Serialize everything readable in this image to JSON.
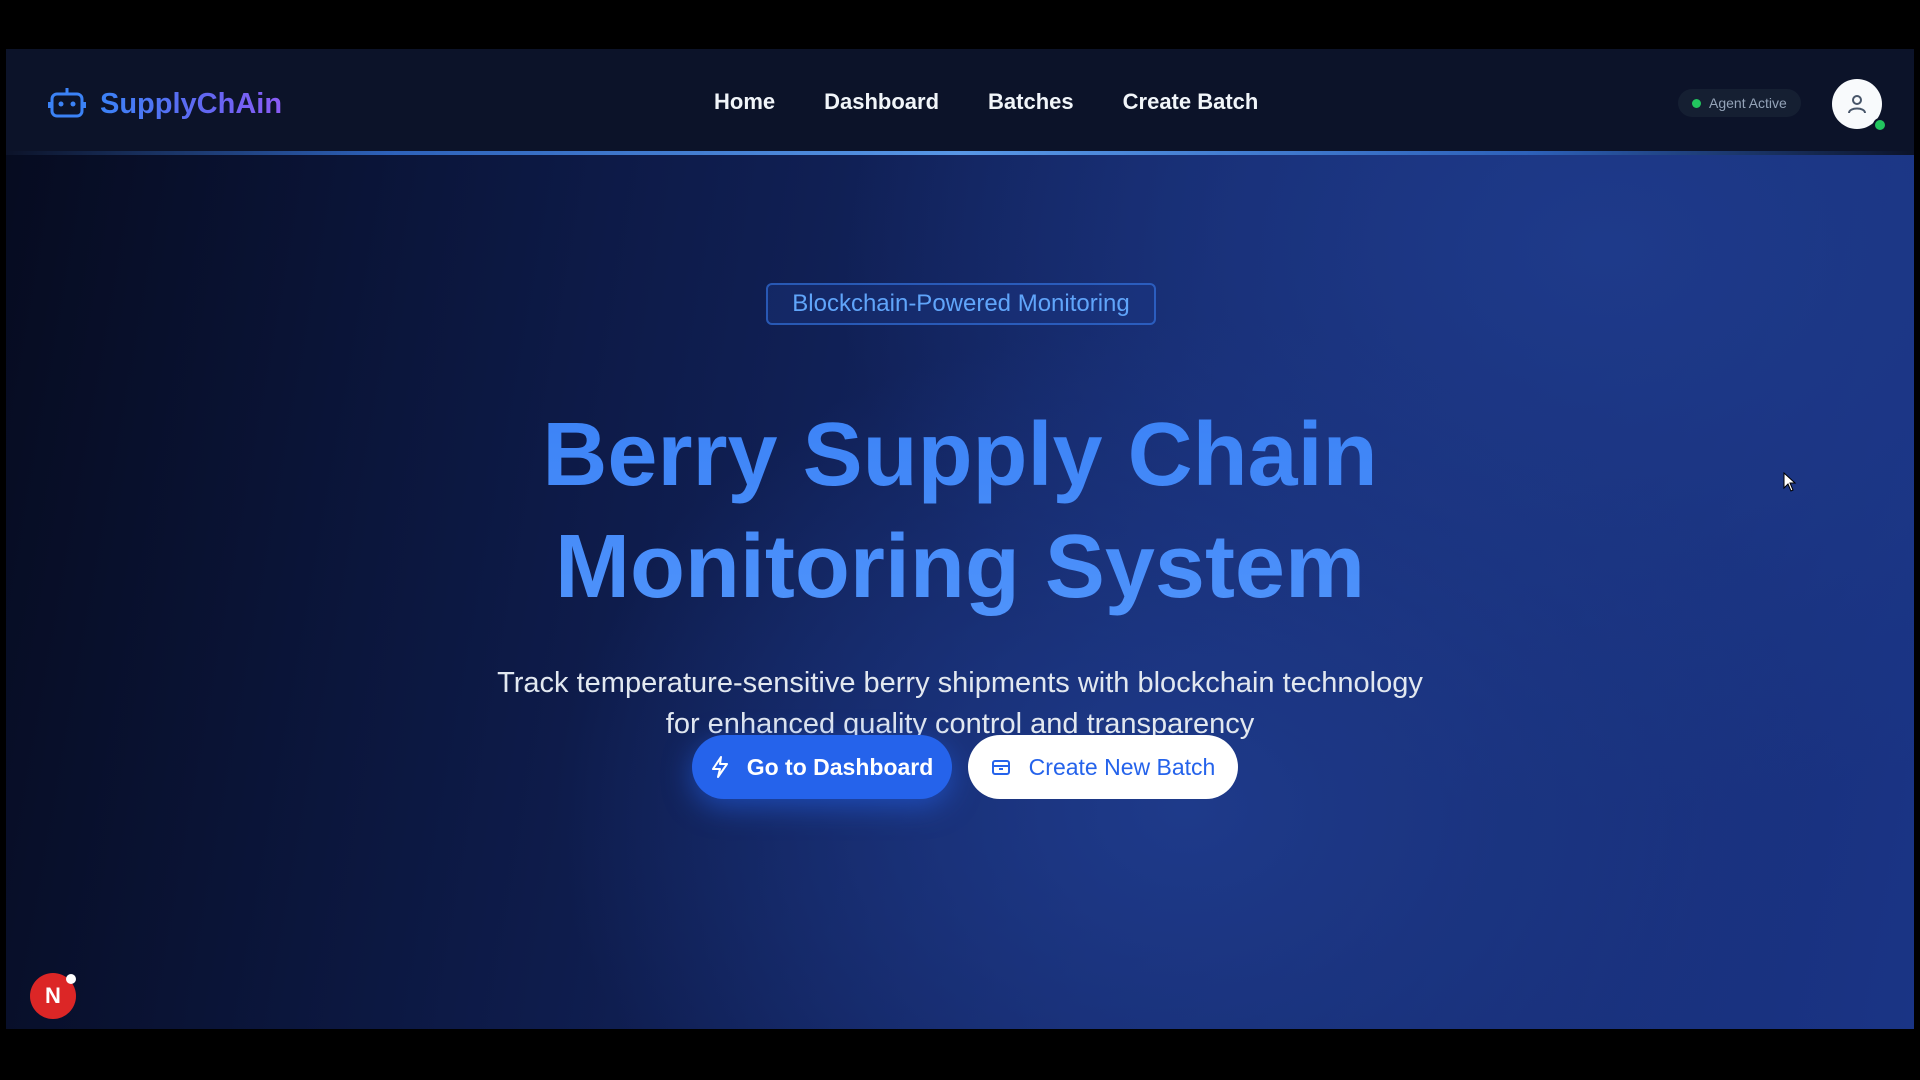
{
  "header": {
    "brand": "SupplyChAin",
    "brand_icon": "robot-icon",
    "nav": [
      {
        "label": "Home"
      },
      {
        "label": "Dashboard"
      },
      {
        "label": "Batches"
      },
      {
        "label": "Create Batch"
      }
    ],
    "agent_status": "Agent Active",
    "agent_status_color": "#22c55e",
    "avatar_icon": "user-icon"
  },
  "hero": {
    "badge": "Blockchain-Powered Monitoring",
    "title_line1": "Berry Supply Chain",
    "title_line2": "Monitoring System",
    "subtitle_line1": "Track temperature-sensitive berry shipments with blockchain technology",
    "subtitle_line2": "for enhanced quality control and transparency",
    "primary_button": {
      "label": "Go to Dashboard",
      "icon": "lightning-icon"
    },
    "secondary_button": {
      "label": "Create New Batch",
      "icon": "box-icon"
    }
  },
  "floating": {
    "badge_letter": "N"
  },
  "colors": {
    "accent": "#3b82f6",
    "primary_button": "#2563eb",
    "navbar": "#0c1329"
  }
}
